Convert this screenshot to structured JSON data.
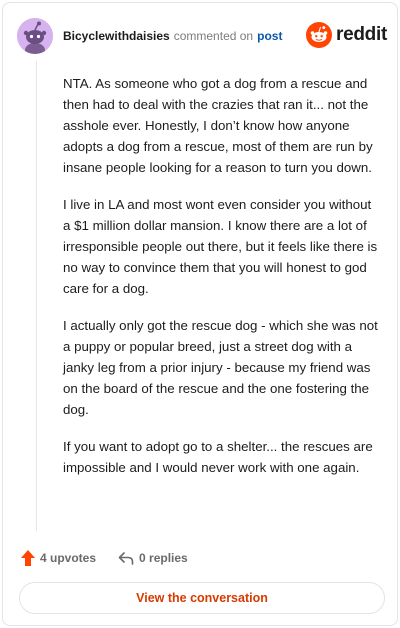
{
  "header": {
    "username": "Bicyclewithdaisies",
    "action_text": "commented on",
    "post_link": "post",
    "brand": "reddit"
  },
  "comment": {
    "paragraphs": [
      "NTA. As someone who got a dog from a rescue and then had to deal with the crazies that ran it... not the asshole ever. Honestly, I don’t know how anyone adopts a dog from a rescue, most of them are run by insane people looking for a reason to turn you down.",
      "I live in LA and most wont even consider you without a $1 million dollar mansion. I know there are a lot of irresponsible people out there, but it feels like there is no way to convince them that you will honest to god care for a dog.",
      "I actually only got the rescue dog - which she was not a puppy or popular breed, just a street dog with a janky leg from a prior injury - because my friend was on the board of the rescue and the one fostering the dog.",
      "If you want to adopt go to a shelter... the rescues are impossible and I would never work with one again."
    ]
  },
  "footer": {
    "upvotes": "4 upvotes",
    "replies": "0 replies",
    "cta": "View the conversation"
  },
  "colors": {
    "brand_orange": "#ff4500",
    "link_blue": "#0a58aa",
    "cta_text": "#d93a00",
    "avatar_bg": "#d6b3ef"
  },
  "icons": {
    "avatar": "snoo-avatar",
    "brand": "reddit-logo-icon",
    "upvote": "upvote-arrow-icon",
    "reply": "reply-arrow-icon"
  }
}
